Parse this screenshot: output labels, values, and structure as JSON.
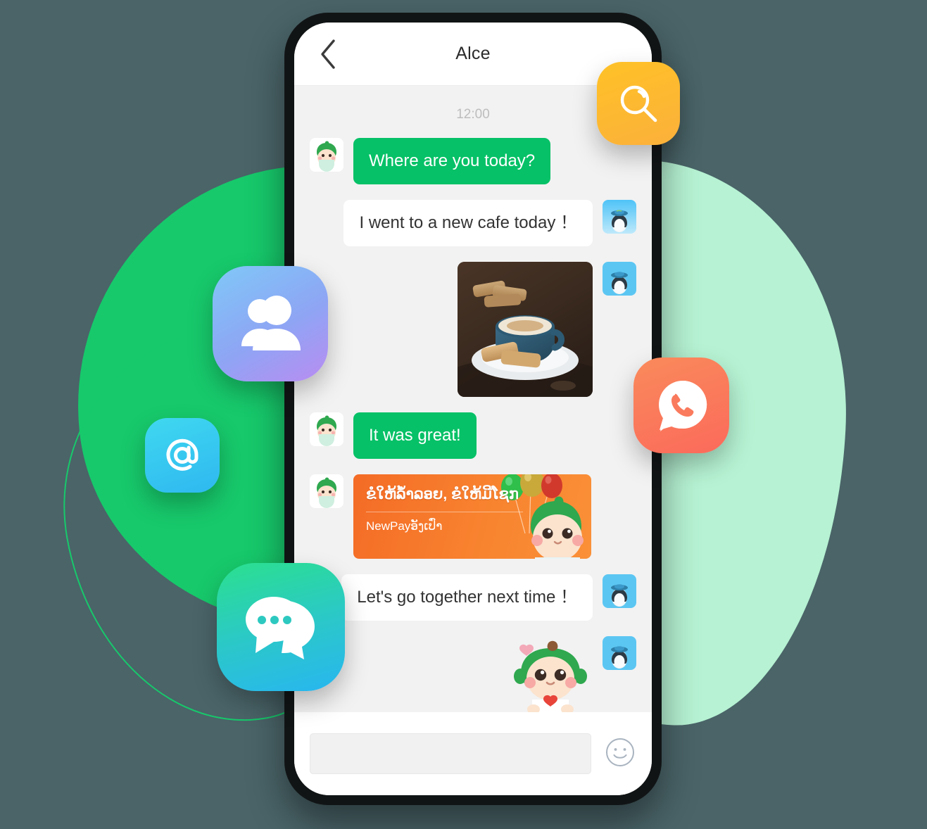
{
  "phone": {
    "navbar": {
      "back_icon": "chevron-left-icon",
      "title": "Alce"
    },
    "conversation": {
      "timestamp": "12:00",
      "messages": [
        {
          "id": "m1",
          "side": "left",
          "type": "text",
          "text": "Where are you today?",
          "avatar": "green-mascot-avatar"
        },
        {
          "id": "m2",
          "side": "right",
          "type": "text",
          "text": "I went to a new cafe today ！",
          "avatar": "penguin-avatar"
        },
        {
          "id": "m3",
          "side": "right",
          "type": "photo",
          "text": "coffee-cup-and-biscotti-photo",
          "avatar": "penguin-avatar"
        },
        {
          "id": "m4",
          "side": "left",
          "type": "text",
          "text": "It was great!",
          "avatar": "green-mascot-avatar"
        },
        {
          "id": "m5",
          "side": "left",
          "type": "promo",
          "title": "ຂໍໃຫ້ລ້ຳລອຍ, ຂໍໃຫ້ມີໂຊກ",
          "subtitle": "NewPayອັງເປົ່າ",
          "avatar": "green-mascot-avatar"
        },
        {
          "id": "m6",
          "side": "right",
          "type": "text",
          "text": "Let's go together next time ！",
          "avatar": "penguin-avatar"
        },
        {
          "id": "m7",
          "side": "right",
          "type": "sticker",
          "text": "green-haired-mascot-sticker",
          "avatar": "penguin-avatar"
        }
      ]
    },
    "input_bar": {
      "value": "",
      "placeholder": "",
      "emoji_icon": "smiley-face-icon"
    }
  },
  "floating_icons": [
    {
      "id": "search",
      "icon": "search-icon",
      "label": "Search"
    },
    {
      "id": "contacts",
      "icon": "contacts-icon",
      "label": "Contacts"
    },
    {
      "id": "mention",
      "icon": "at-mention-icon",
      "label": "Mention"
    },
    {
      "id": "call",
      "icon": "phone-bubble-icon",
      "label": "Call"
    },
    {
      "id": "chats",
      "icon": "chat-bubbles-icon",
      "label": "Chats"
    }
  ],
  "colors": {
    "bubble_out": "#06C167",
    "bubble_in": "#FFFFFF",
    "screen_bg": "#F2F2F2",
    "blob_green": "#17C96B",
    "blob_mint": "#B6F2D3",
    "promo_orange": "#F8832F",
    "icon_search": "#FBB03B",
    "icon_call": "#FB6A5B"
  }
}
